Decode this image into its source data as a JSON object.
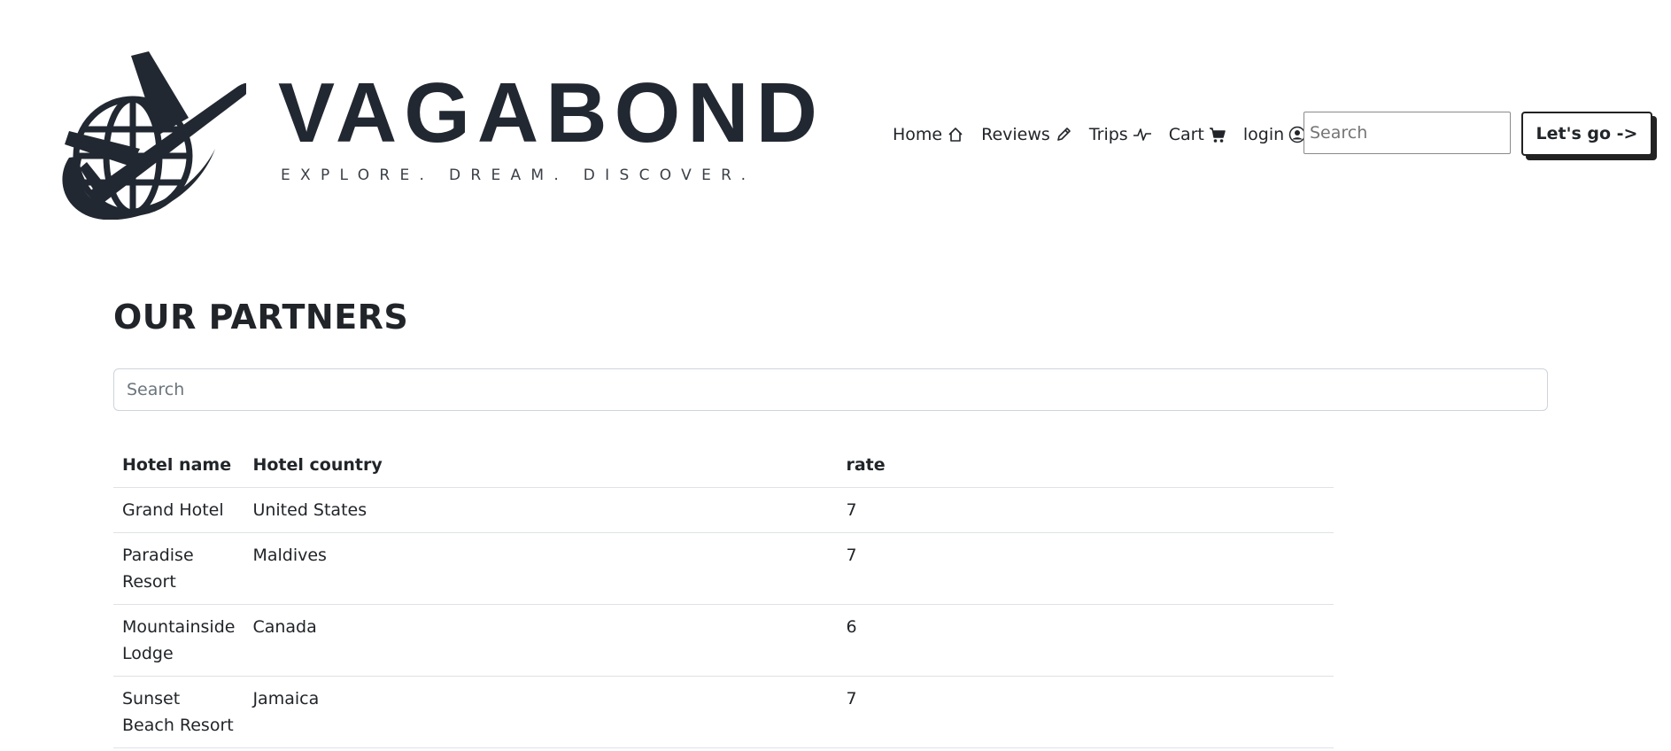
{
  "brand": {
    "name": "VAGABOND",
    "tagline": "EXPLORE. DREAM. DISCOVER."
  },
  "nav": {
    "items": [
      {
        "label": "Home",
        "icon": "house-icon"
      },
      {
        "label": "Reviews",
        "icon": "pencil-icon"
      },
      {
        "label": "Trips",
        "icon": "activity-icon"
      },
      {
        "label": "Cart",
        "icon": "cart-icon"
      },
      {
        "label": "login",
        "icon": "user-circle-icon"
      }
    ],
    "search_placeholder": "Search",
    "go_button": "Let's go ->"
  },
  "page": {
    "title": "OUR PARTNERS",
    "search_placeholder": "Search"
  },
  "table": {
    "headers": [
      "Hotel name",
      "Hotel country",
      "rate"
    ],
    "rows": [
      [
        "Grand Hotel",
        "United States",
        "7"
      ],
      [
        "Paradise Resort",
        "Maldives",
        "7"
      ],
      [
        "Mountainside Lodge",
        "Canada",
        "6"
      ],
      [
        "Sunset Beach Resort",
        "Jamaica",
        "7"
      ]
    ]
  },
  "colors": {
    "brand": "#222831",
    "text": "#212529",
    "border": "#dee2e6"
  }
}
